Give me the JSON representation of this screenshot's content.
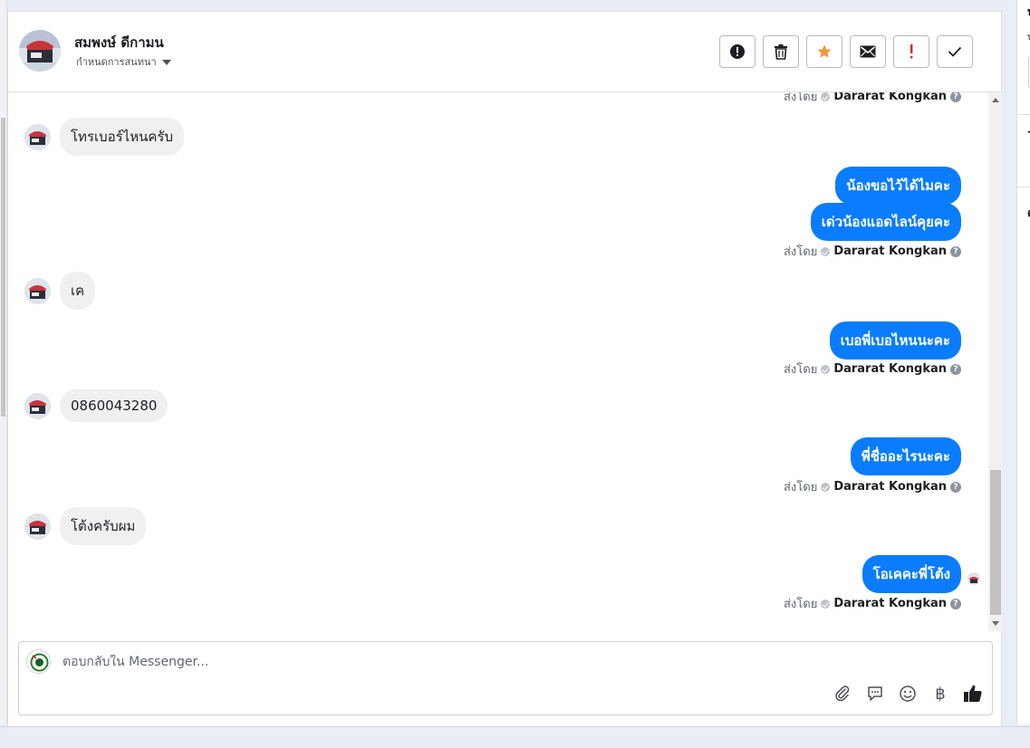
{
  "contact": {
    "name": "สมพงษ์ ดีกามน",
    "assign_label": "กำหนดการสนทนา"
  },
  "actions": [
    {
      "name": "spam-button",
      "icon": "exclamation-circle-icon"
    },
    {
      "name": "delete-button",
      "icon": "trash-icon"
    },
    {
      "name": "star-button",
      "icon": "star-icon",
      "color": "#f7923a"
    },
    {
      "name": "mark-unread-button",
      "icon": "envelope-icon"
    },
    {
      "name": "follow-up-button",
      "icon": "exclamation-icon",
      "color": "#e02020"
    },
    {
      "name": "mark-done-button",
      "icon": "checkmark-icon"
    }
  ],
  "sent_by_label": "ส่งโดย",
  "agent_name": "Dararat Kongkan",
  "messages": {
    "in_1": "โทรเบอร์ไหนครับ",
    "out_1": "น้องขอไว้ได้ไมคะ",
    "out_2": "เด่วน้องแอดไลน์คุยคะ",
    "in_2": "เค",
    "out_3": "เบอพี่เบอไหนนะคะ",
    "in_3": "0860043280",
    "out_4": "พี่ชื่ออะไรนะคะ",
    "in_4": "โต้งครับผม",
    "out_5": "โอเคคะพี่โต้ง"
  },
  "composer": {
    "placeholder": "ตอบกลับใน Messenger...",
    "tools": [
      "paperclip-icon",
      "saved-reply-icon",
      "emoji-icon",
      "baht-icon",
      "thumbs-up-icon"
    ],
    "baht_symbol": "฿"
  },
  "right_panel": {
    "frag_1": "บ",
    "frag_2": "น",
    "frag_3": "-",
    "frag_4": "ต"
  },
  "colors": {
    "outgoing_bubble": "#0a7cff",
    "incoming_bubble": "#f0f0f0"
  }
}
